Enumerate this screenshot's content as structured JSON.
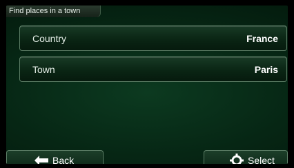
{
  "header": {
    "title": "Find places in a town"
  },
  "fields": [
    {
      "label": "Country",
      "value": "France"
    },
    {
      "label": "Town",
      "value": "Paris"
    }
  ],
  "footer": {
    "back_label": "Back",
    "select_label": "Select"
  },
  "colors": {
    "background": "#062614",
    "border": "#5d7f67",
    "text": "#ffffff"
  },
  "icons": {
    "back": "left-arrow-icon",
    "select": "crosshair-target-icon"
  }
}
